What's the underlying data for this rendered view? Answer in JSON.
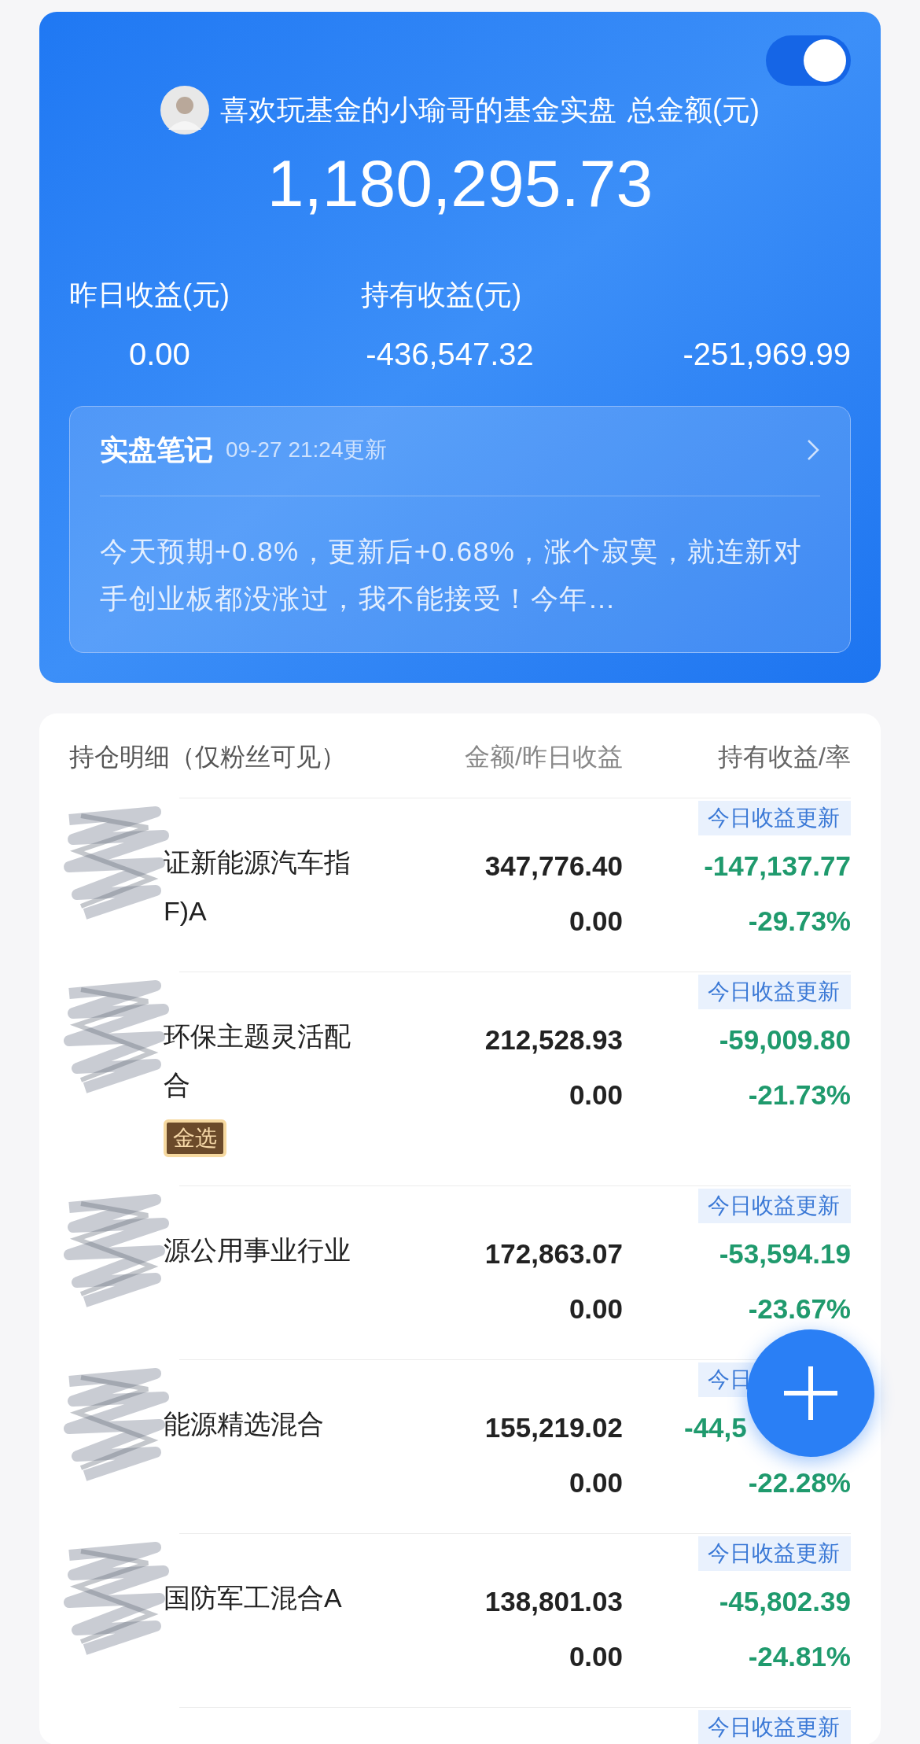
{
  "summary": {
    "title": "喜欢玩基金的小瑜哥的基金实盘",
    "total_label": "总金额(元)",
    "total": "1,180,295.73",
    "toggle": {
      "on": true
    },
    "stats": [
      {
        "label": "昨日收益(元)",
        "value": "0.00"
      },
      {
        "label": "持有收益(元)",
        "value": "-436,547.32"
      },
      {
        "value": "-251,969.99"
      }
    ],
    "note": {
      "title": "实盘笔记",
      "time": "09-27 21:24更新",
      "text": "今天预期+0.8%，更新后+0.68%，涨个寂寞，就连新对手创业板都没涨过，我不能接受！今年…"
    }
  },
  "holdings": {
    "columns": [
      "持仓明细（仅粉丝可见）",
      "金额/昨日收益",
      "持有收益/率"
    ],
    "rows": [
      {
        "badge": "今日收益更新",
        "name_lines": [
          "证新能源汽车指",
          "F)A"
        ],
        "amount": "347,776.40",
        "yesterday": "0.00",
        "profit": "-147,137.77",
        "rate": "-29.73%"
      },
      {
        "badge": "今日收益更新",
        "name_lines": [
          "环保主题灵活配",
          "合"
        ],
        "tag": "金选",
        "amount": "212,528.93",
        "yesterday": "0.00",
        "profit": "-59,009.80",
        "rate": "-21.73%"
      },
      {
        "badge": "今日收益更新",
        "name_lines": [
          "源公用事业行业"
        ],
        "amount": "172,863.07",
        "yesterday": "0.00",
        "profit": "-53,594.19",
        "rate": "-23.67%"
      },
      {
        "badge": "今日",
        "name_lines": [
          "能源精选混合"
        ],
        "amount": "155,219.02",
        "yesterday": "0.00",
        "profit": "-44,5",
        "profit_covered": true,
        "rate": "-22.28%"
      },
      {
        "badge": "今日收益更新",
        "name_lines": [
          "国防军工混合A"
        ],
        "amount": "138,801.03",
        "yesterday": "0.00",
        "profit": "-45,802.39",
        "rate": "-24.81%"
      },
      {
        "badge": "今日收益更新"
      }
    ]
  }
}
